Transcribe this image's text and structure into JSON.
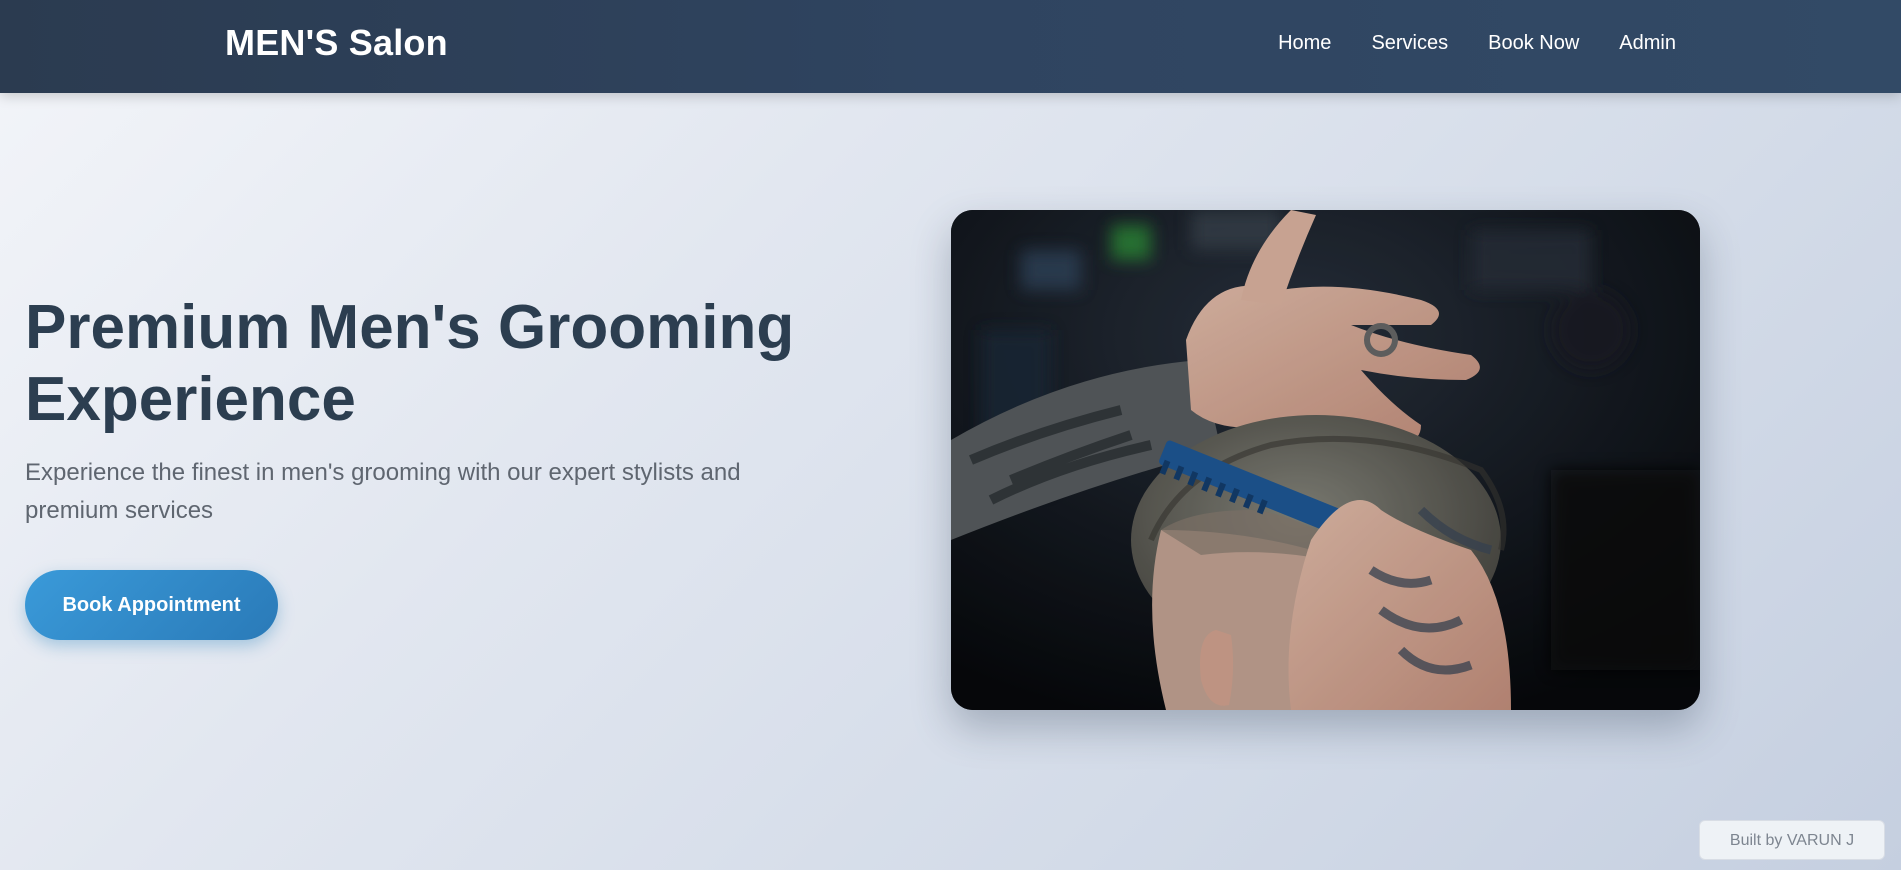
{
  "navbar": {
    "brand": "MEN'S Salon",
    "links": [
      {
        "label": "Home"
      },
      {
        "label": "Services"
      },
      {
        "label": "Book Now"
      },
      {
        "label": "Admin"
      }
    ]
  },
  "hero": {
    "title": "Premium Men's Grooming Experience",
    "subtitle": "Experience the finest in men's grooming with our expert stylists and premium services",
    "cta_label": "Book Appointment"
  },
  "footer": {
    "credit": "Built by VARUN J"
  },
  "colors": {
    "navbar": "#2c3e50",
    "title": "#2c3e50",
    "accent": "#3498db"
  }
}
